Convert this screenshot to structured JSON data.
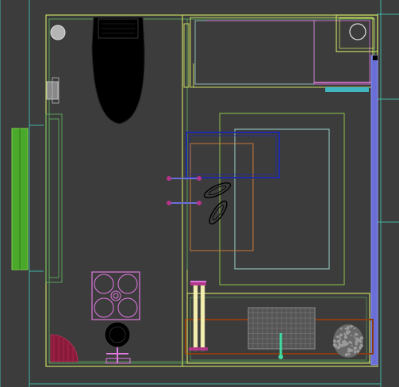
{
  "viewport": {
    "background": "#3c3c3c",
    "colors": {
      "room_outline": "#c8d860",
      "wall_line": "#5fb85f",
      "guide_line": "#3fb6a6",
      "accent_blue": "#1f2aa8",
      "accent_orange": "#c8783a",
      "accent_pink": "#e07ae0",
      "accent_brown": "#8b3d12",
      "accent_periwinkle": "#6a6fd8",
      "accent_green": "#4aa82a",
      "magenta_rod": "#b4348a",
      "light_cyan": "#9fd8d0"
    },
    "objects": [
      "toilet",
      "wall-fixture",
      "bed",
      "nightstand",
      "rug",
      "slippers",
      "hanger-rod",
      "chair",
      "round-table",
      "desk",
      "potted-plant",
      "radiator",
      "door-swing",
      "wardrobe"
    ]
  }
}
